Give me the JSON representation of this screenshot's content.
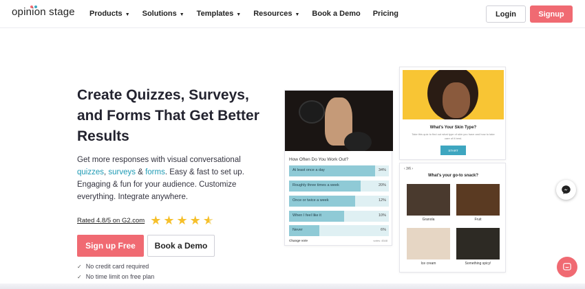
{
  "brand": {
    "logo_text": "opinion stage",
    "accent_color": "#f06a72",
    "link_color": "#1d9ab4"
  },
  "nav": {
    "items": [
      {
        "label": "Products",
        "has_dropdown": true
      },
      {
        "label": "Solutions",
        "has_dropdown": true
      },
      {
        "label": "Templates",
        "has_dropdown": true
      },
      {
        "label": "Resources",
        "has_dropdown": true
      },
      {
        "label": "Book a Demo",
        "has_dropdown": false
      },
      {
        "label": "Pricing",
        "has_dropdown": false
      }
    ],
    "login_label": "Login",
    "signup_label": "Signup"
  },
  "hero": {
    "title": "Create Quizzes, Surveys, and Forms That Get Better Results",
    "desc_before": "Get more responses with visual conversational ",
    "desc_link1": "quizzes",
    "desc_sep1": ", ",
    "desc_link2": "surveys",
    "desc_sep2": " & ",
    "desc_link3": "forms",
    "desc_after": ". Easy & fast to set up. Engaging & fun for your audience. Customize everything. Integrate anywhere.",
    "rating_text": "Rated 4.8/5 on G2.com",
    "rating_stars": 4.5,
    "cta_label": "Sign up Free",
    "demo_label": "Book a Demo",
    "checks": [
      "No credit card required",
      "No time limit on free plan"
    ]
  },
  "poll_card": {
    "question": "How Often Do You Work Out?",
    "options": [
      {
        "label": "At least once a day",
        "pct": "34%",
        "fill": 0.86
      },
      {
        "label": "Roughly three times a week",
        "pct": "20%",
        "fill": 0.72
      },
      {
        "label": "Once or twice a week",
        "pct": "12%",
        "fill": 0.66
      },
      {
        "label": "When I feel like it",
        "pct": "10%",
        "fill": 0.55
      },
      {
        "label": "Never",
        "pct": "6%",
        "fill": 0.3
      }
    ],
    "footer_left": "Change vote",
    "footer_right": "votes: 4548"
  },
  "quiz_card": {
    "title": "What's Your Skin Type?",
    "subtitle": "Take this quiz to find out what type of skin you have and how to take care of it best.",
    "start_label": "START"
  },
  "snack_card": {
    "nav_text": "‹ 3/6 ›",
    "title": "What's your go-to snack?",
    "tiles": [
      {
        "label": "Granola",
        "color": "#4a3a2e"
      },
      {
        "label": "Fruit",
        "color": "#5a3a22"
      },
      {
        "label": "Ice cream",
        "color": "#e6d6c4"
      },
      {
        "label": "Something spicy!",
        "color": "#2d2a24"
      }
    ]
  },
  "floating": {
    "messenger_icon": "messenger-icon",
    "chat_icon": "chat-icon"
  }
}
